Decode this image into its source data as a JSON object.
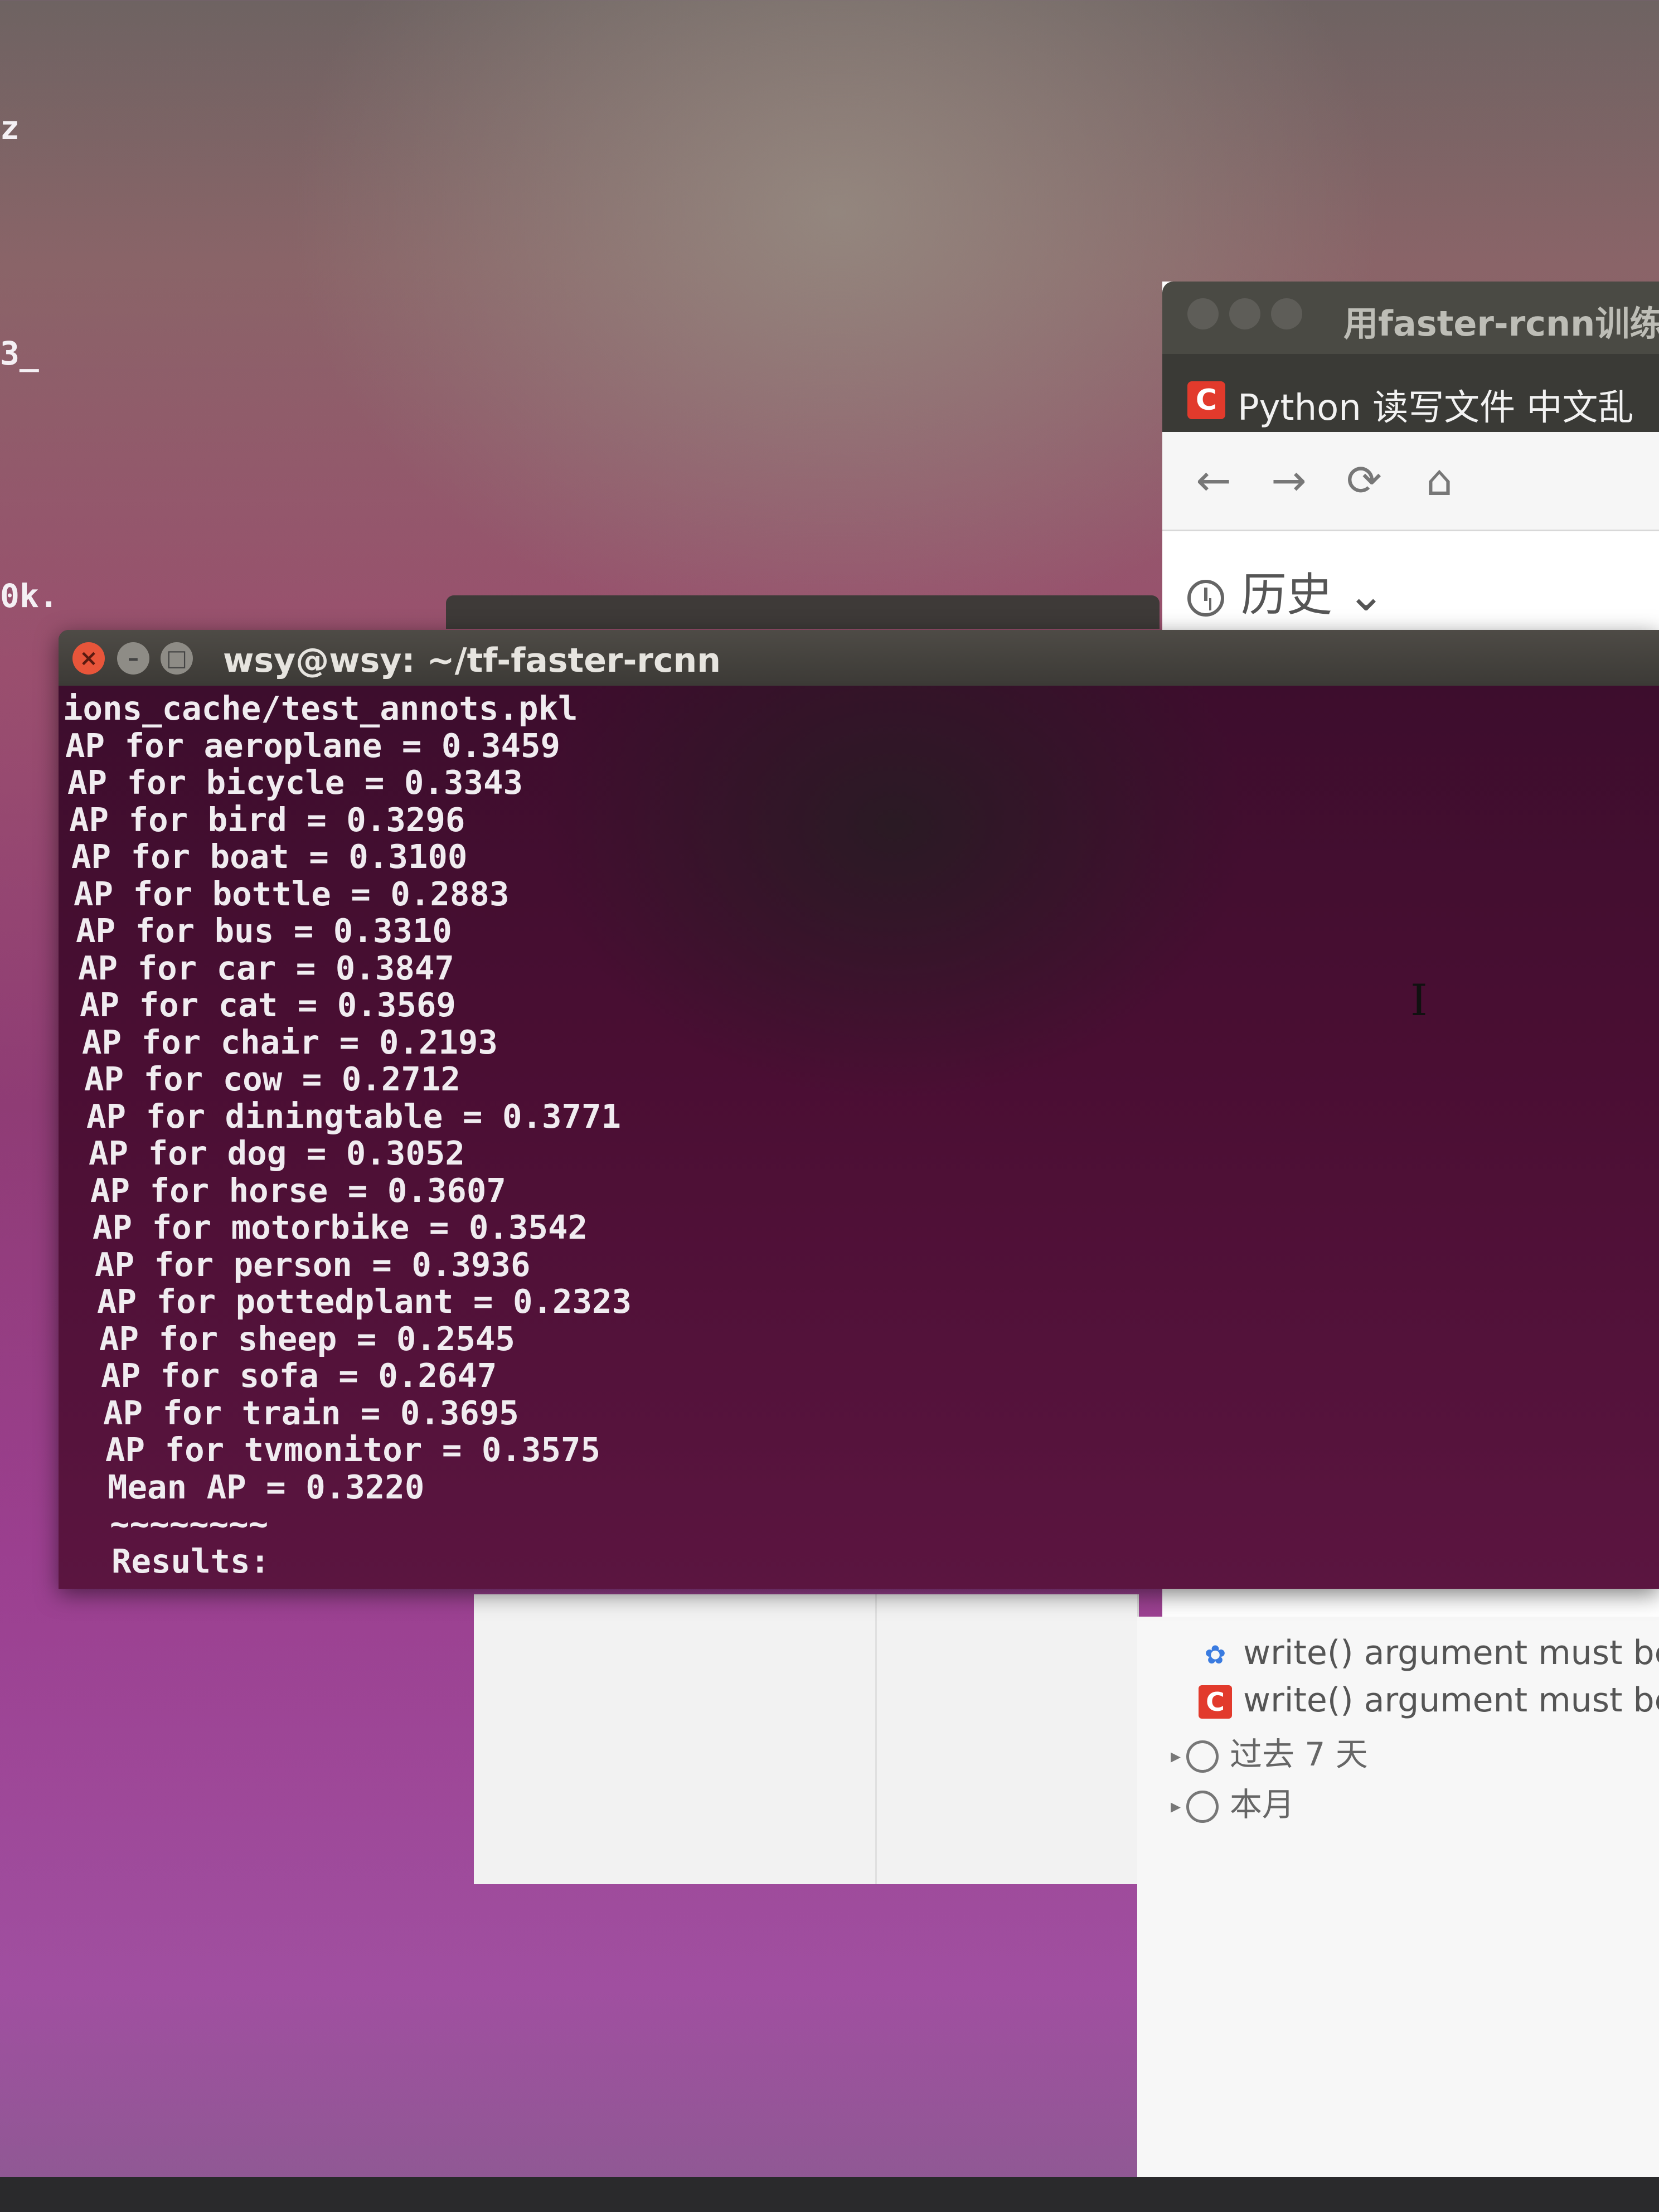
{
  "desktop": {
    "fragments": [
      "z",
      "3_",
      "0k."
    ]
  },
  "browser": {
    "window_title": "用faster-rcnn训练",
    "tab_title": "Python 读写文件 中文乱",
    "tab_favicon": "C",
    "nav": {
      "back_icon": "←",
      "forward_icon": "→",
      "reload_icon": "⟳",
      "home_icon": "⌂"
    },
    "history_label": "历史",
    "history_chevron": "⌄",
    "history_items": [
      {
        "icon": "paw",
        "text": "write() argument must be s"
      },
      {
        "icon": "C",
        "text": "write() argument must be s"
      }
    ],
    "history_groups": [
      "过去 7 天",
      "本月"
    ]
  },
  "terminal": {
    "title": "wsy@wsy: ~/tf-faster-rcnn",
    "lines": [
      "ions_cache/test_annots.pkl",
      "AP for aeroplane = 0.3459",
      "AP for bicycle = 0.3343",
      "AP for bird = 0.3296",
      "AP for boat = 0.3100",
      "AP for bottle = 0.2883",
      "AP for bus = 0.3310",
      "AP for car = 0.3847",
      "AP for cat = 0.3569",
      "AP for chair = 0.2193",
      "AP for cow = 0.2712",
      "AP for diningtable = 0.3771",
      "AP for dog = 0.3052",
      "AP for horse = 0.3607",
      "AP for motorbike = 0.3542",
      "AP for person = 0.3936",
      "AP for pottedplant = 0.2323",
      "AP for sheep = 0.2545",
      "AP for sofa = 0.2647",
      "AP for train = 0.3695",
      "AP for tvmonitor = 0.3575",
      "Mean AP = 0.3220",
      "~~~~~~~~",
      "Results:"
    ]
  },
  "colors": {
    "terminal_bg": "#4a0e33",
    "close_button": "#e8553a",
    "favicon_red": "#e23a2c"
  }
}
